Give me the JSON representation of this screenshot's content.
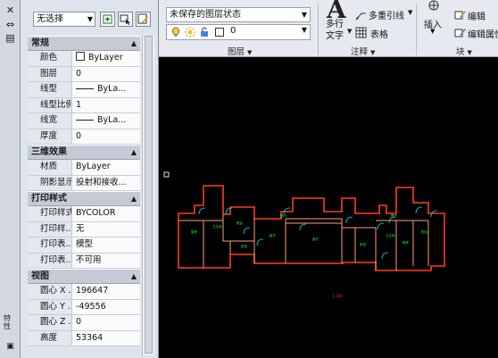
{
  "left_strip": {
    "close_glyph": "✕",
    "pin_glyph": "⇔",
    "menu_glyph": "▤",
    "vertical_label": "特性"
  },
  "palette": {
    "selection": "无选择",
    "sections": [
      {
        "title": "常规",
        "rows": [
          {
            "key": "颜色",
            "value": "ByLayer",
            "style": "box"
          },
          {
            "key": "图层",
            "value": "0",
            "style": "plain"
          },
          {
            "key": "线型",
            "value": "ByLa...",
            "style": "line"
          },
          {
            "key": "线型比例",
            "value": "1",
            "style": "plain"
          },
          {
            "key": "线宽",
            "value": "ByLa...",
            "style": "line"
          },
          {
            "key": "厚度",
            "value": "0",
            "style": "plain"
          }
        ]
      },
      {
        "title": "三维效果",
        "rows": [
          {
            "key": "材质",
            "value": "ByLayer",
            "style": "plain"
          },
          {
            "key": "阴影显示",
            "value": "投射和接收...",
            "style": "plain"
          }
        ]
      },
      {
        "title": "打印样式",
        "rows": [
          {
            "key": "打印样式",
            "value": "BYCOLOR",
            "style": "plain"
          },
          {
            "key": "打印样...",
            "value": "无",
            "style": "plain"
          },
          {
            "key": "打印表...",
            "value": "模型",
            "style": "plain"
          },
          {
            "key": "打印表...",
            "value": "不可用",
            "style": "plain"
          }
        ]
      },
      {
        "title": "视图",
        "rows": [
          {
            "key": "圆心 X ...",
            "value": "196647",
            "style": "plain"
          },
          {
            "key": "圆心 Y ...",
            "value": "-49556",
            "style": "plain"
          },
          {
            "key": "圆心 Z ...",
            "value": "0",
            "style": "plain"
          },
          {
            "key": "高度",
            "value": "53364",
            "style": "plain"
          }
        ]
      }
    ]
  },
  "ribbon": {
    "layer_state": "未保存的图层状态",
    "layer_current": "0",
    "layers_panel": "图层",
    "annotation_panel": "注释",
    "block_panel": "块",
    "mtext_label_1": "多行",
    "mtext_label_2": "文字",
    "multileader": "多重引线",
    "table": "表格",
    "insert": "插入",
    "edit": "编辑",
    "edit_attr": "编辑属性"
  },
  "colors": {
    "wall": "#ff3c1e",
    "wall_inner": "#ff9a7a",
    "door": "#00e0ff",
    "text": "#22ff22",
    "dim_mark": "#ff2a2a",
    "canvas_bg": "#000000"
  },
  "canvas": {
    "room_labels": [
      "厨房",
      "卫生间",
      "卧室",
      "客厅",
      "客厅",
      "卧室",
      "卫生间",
      "厨房",
      "阳台",
      "阳台",
      "餐厅",
      "餐厅"
    ],
    "scale_mark": "1:100"
  }
}
